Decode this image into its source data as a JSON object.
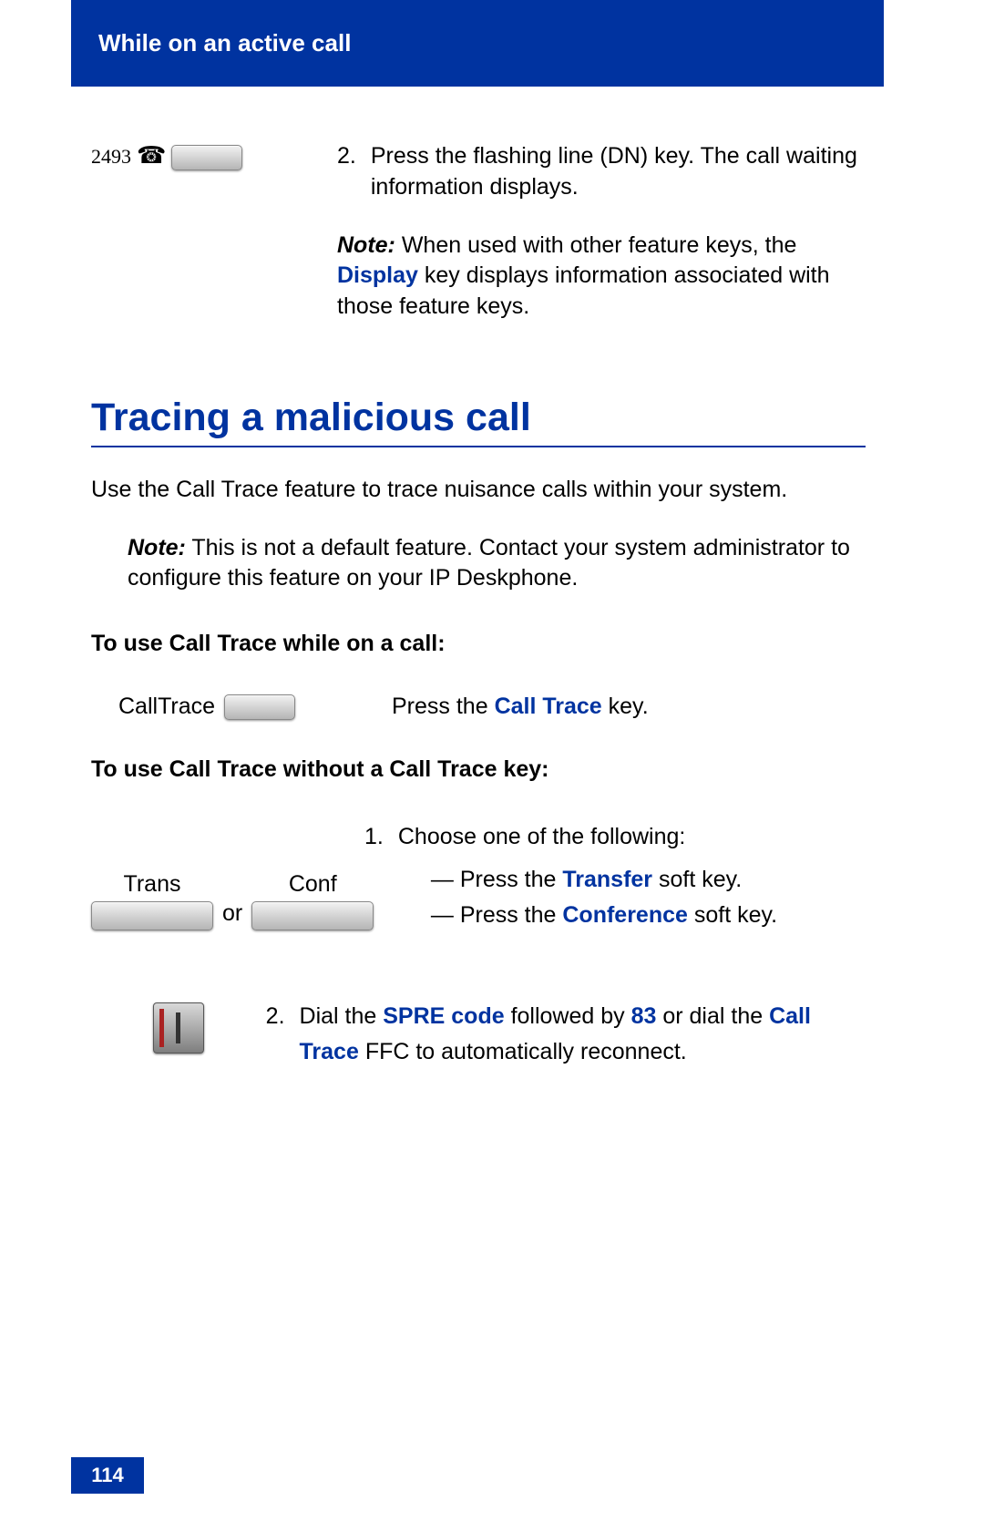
{
  "header": {
    "title": "While on an active call"
  },
  "step2": {
    "dn": "2493",
    "num": "2.",
    "text": "Press the flashing line (DN) key. The call waiting information displays."
  },
  "note1": {
    "label": "Note:",
    "before": " When used with other feature keys, the ",
    "key": "Display",
    "after": " key displays information associated with those feature keys."
  },
  "section": {
    "title": "Tracing a malicious call"
  },
  "intro": "Use the Call Trace feature to trace nuisance calls within your system.",
  "note2": {
    "label": "Note:",
    "text": "  This is not a default feature. Contact your system administrator to configure this feature on your IP Deskphone."
  },
  "sub1": "To use Call Trace while on a call:",
  "calltrace": {
    "keylabel": "CallTrace",
    "before": "Press the ",
    "key": "Call Trace",
    "after": " key."
  },
  "sub2": "To use Call Trace without a Call Trace key:",
  "transconf": {
    "trans": "Trans",
    "conf": "Conf",
    "or": "or",
    "num": "1.",
    "lead": "Choose one of the following:",
    "opt1_before": "Press the ",
    "opt1_key": "Transfer",
    "opt1_after": " soft key.",
    "opt2_before": "Press the ",
    "opt2_key": "Conference",
    "opt2_after": " soft key."
  },
  "dial": {
    "num": "2.",
    "t1": "Dial the ",
    "k1": "SPRE code",
    "t2": " followed by ",
    "k2": "83",
    "t3": " or dial the ",
    "k3": "Call Trace",
    "t4": " FFC to automatically reconnect."
  },
  "page_number": "114"
}
